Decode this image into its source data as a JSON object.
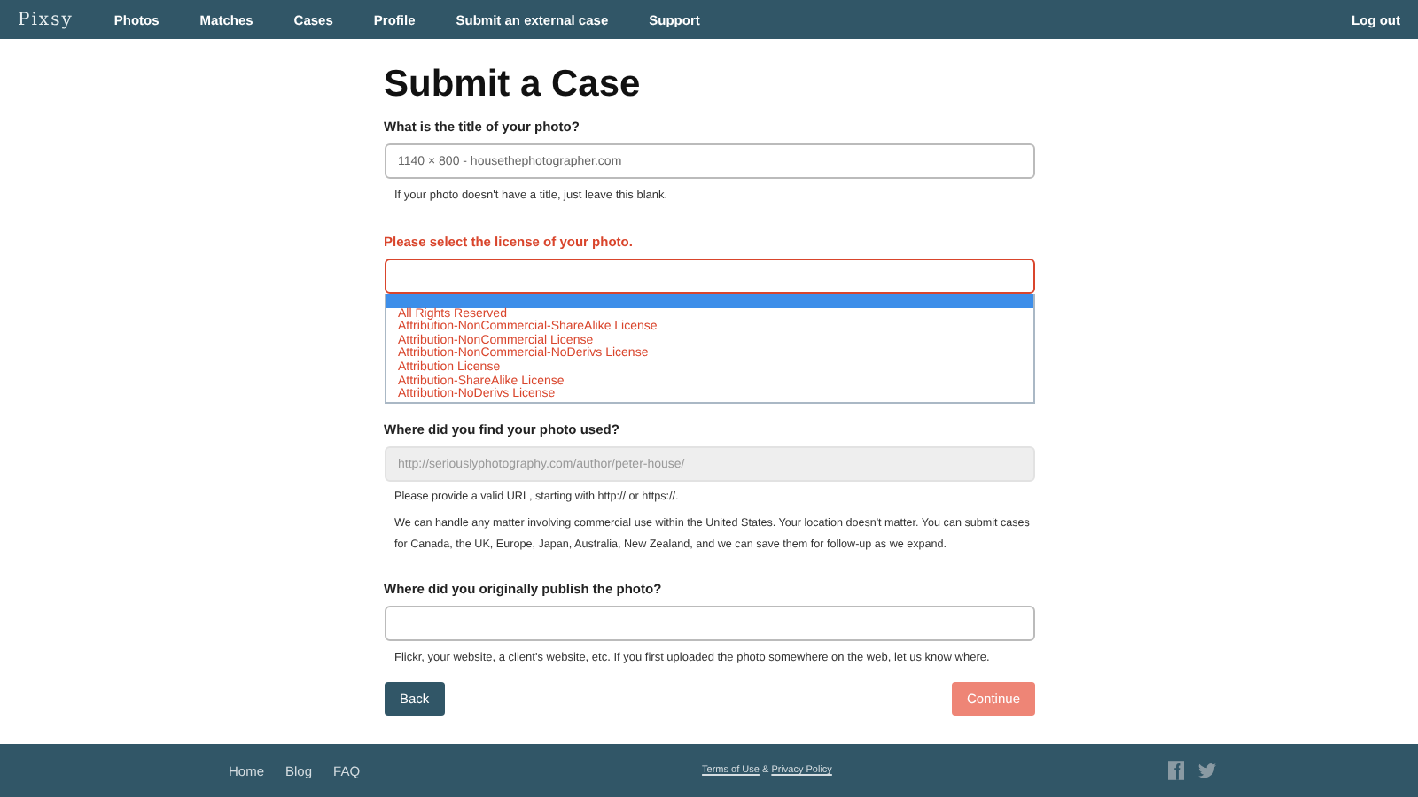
{
  "nav": {
    "logo": "Pixsy",
    "items": [
      "Photos",
      "Matches",
      "Cases",
      "Profile",
      "Submit an external case",
      "Support"
    ],
    "logout": "Log out"
  },
  "heading": "Submit a Case",
  "title_field": {
    "label": "What is the title of your photo?",
    "placeholder": "1140 × 800 - housethephotographer.com",
    "hint": "If your photo doesn't have a title, just leave this blank."
  },
  "license_field": {
    "label": "Please select the license of your photo.",
    "error": true,
    "options": [
      {
        "selected": true
      },
      {
        "label": "All Rights Reserved",
        "selected": false
      },
      {
        "label": "Attribution-NonCommercial-ShareAlike License",
        "selected": false
      },
      {
        "label": "Attribution-NonCommercial License",
        "selected": false
      },
      {
        "label": "Attribution-NonCommercial-NoDerivs License",
        "selected": false
      },
      {
        "label": "Attribution License",
        "selected": false
      },
      {
        "label": "Attribution-ShareAlike License",
        "selected": false
      },
      {
        "label": "Attribution-NoDerivs License",
        "selected": false
      }
    ]
  },
  "used_field": {
    "label": "Where did you find your photo used?",
    "value": "http://seriouslyphotography.com/author/peter-house/",
    "disabled": true,
    "hints": [
      "Please provide a valid URL, starting with http:// or https://.",
      "We can handle any matter involving commercial use within the United States. Your location doesn't matter. You can submit cases for Canada, the UK, Europe, Japan, Australia, New Zealand, and we can save them for follow-up as we expand."
    ]
  },
  "published_field": {
    "label": "Where did you originally publish the photo?",
    "hint": "Flickr, your website, a client's website, etc. If you first uploaded the photo somewhere on the web, let us know where."
  },
  "buttons": {
    "back": "Back",
    "continue": "Continue",
    "continue_disabled": true
  },
  "footer": {
    "links": [
      "Home",
      "Blog",
      "FAQ"
    ],
    "legal": {
      "terms": "Terms of Use",
      "separator": "&",
      "privacy": "Privacy Policy"
    }
  }
}
